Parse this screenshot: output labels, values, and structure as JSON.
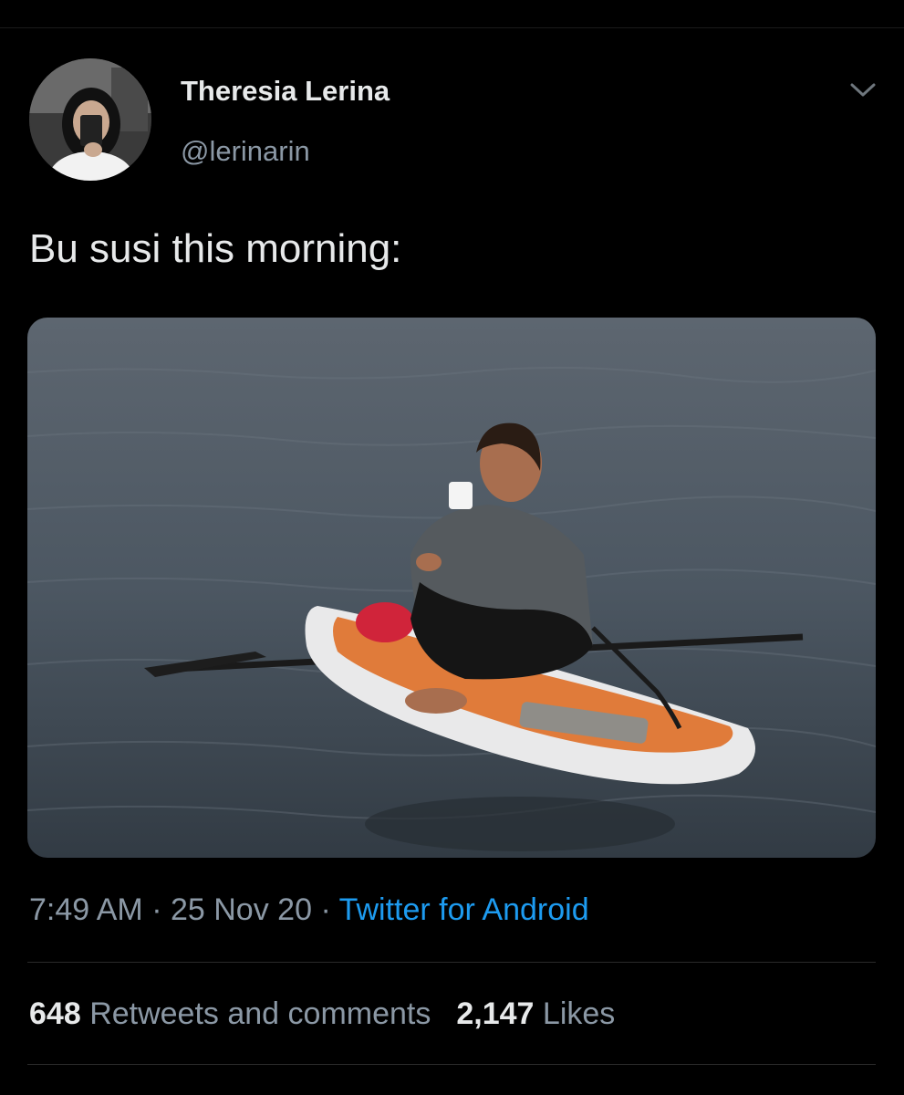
{
  "tweet": {
    "author_name": "Theresia Lerina",
    "author_handle": "@lerinarin",
    "text": "Bu susi this morning:",
    "menu_icon": "chevron-down-icon",
    "time": "7:49 AM",
    "separator": "·",
    "date": "25 Nov 20",
    "source": "Twitter for Android",
    "retweets_count": "648",
    "retweets_label": "Retweets and comments",
    "likes_count": "2,147",
    "likes_label": "Likes"
  },
  "colors": {
    "background": "#000000",
    "text_primary": "#e7e9ea",
    "text_secondary": "#8b98a5",
    "link": "#1d9bf0"
  }
}
